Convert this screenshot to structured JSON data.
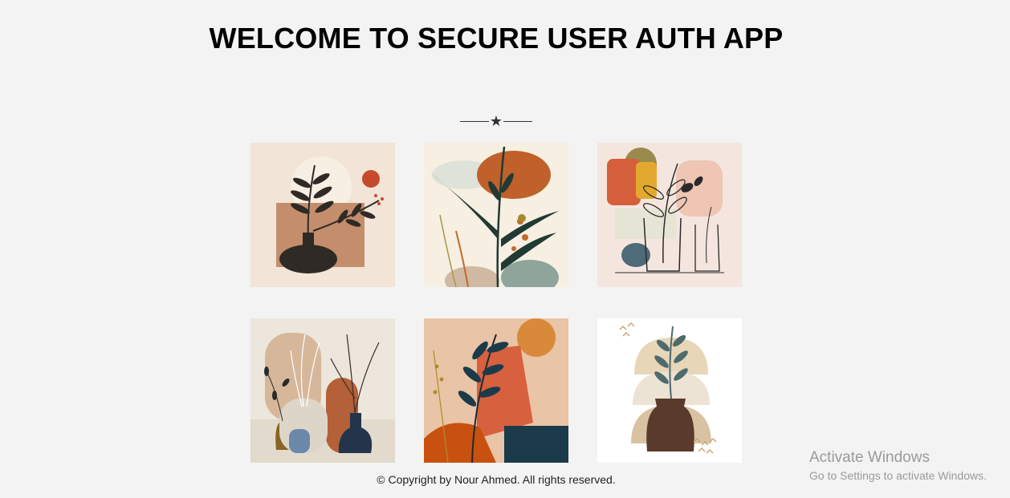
{
  "header": {
    "title": "WELCOME TO SECURE USER AUTH APP"
  },
  "divider": {
    "glyph": "★"
  },
  "gallery": {
    "images": [
      {
        "name": "plant-art-1",
        "palette": [
          "#f2e4d6",
          "#c48e6c",
          "#2f2a26",
          "#c64a2c"
        ]
      },
      {
        "name": "plant-art-2",
        "palette": [
          "#f6efe2",
          "#c0602a",
          "#213a33",
          "#8fa59c"
        ]
      },
      {
        "name": "plant-art-3",
        "palette": [
          "#f4e6df",
          "#d55e3b",
          "#e3a92e",
          "#4f6a78"
        ]
      },
      {
        "name": "plant-art-4",
        "palette": [
          "#ece6dc",
          "#b46039",
          "#8a6424",
          "#23354a"
        ]
      },
      {
        "name": "plant-art-5",
        "palette": [
          "#e9c4a6",
          "#d7603f",
          "#1b3b4b",
          "#c8510f"
        ]
      },
      {
        "name": "plant-art-6",
        "palette": [
          "#ffffff",
          "#d9c2a1",
          "#5a3a2c",
          "#4d6b6d"
        ]
      }
    ]
  },
  "footer": {
    "text": "© Copyright by Nour Ahmed. All rights reserved."
  },
  "watermark": {
    "line1": "Activate Windows",
    "line2": "Go to Settings to activate Windows."
  }
}
